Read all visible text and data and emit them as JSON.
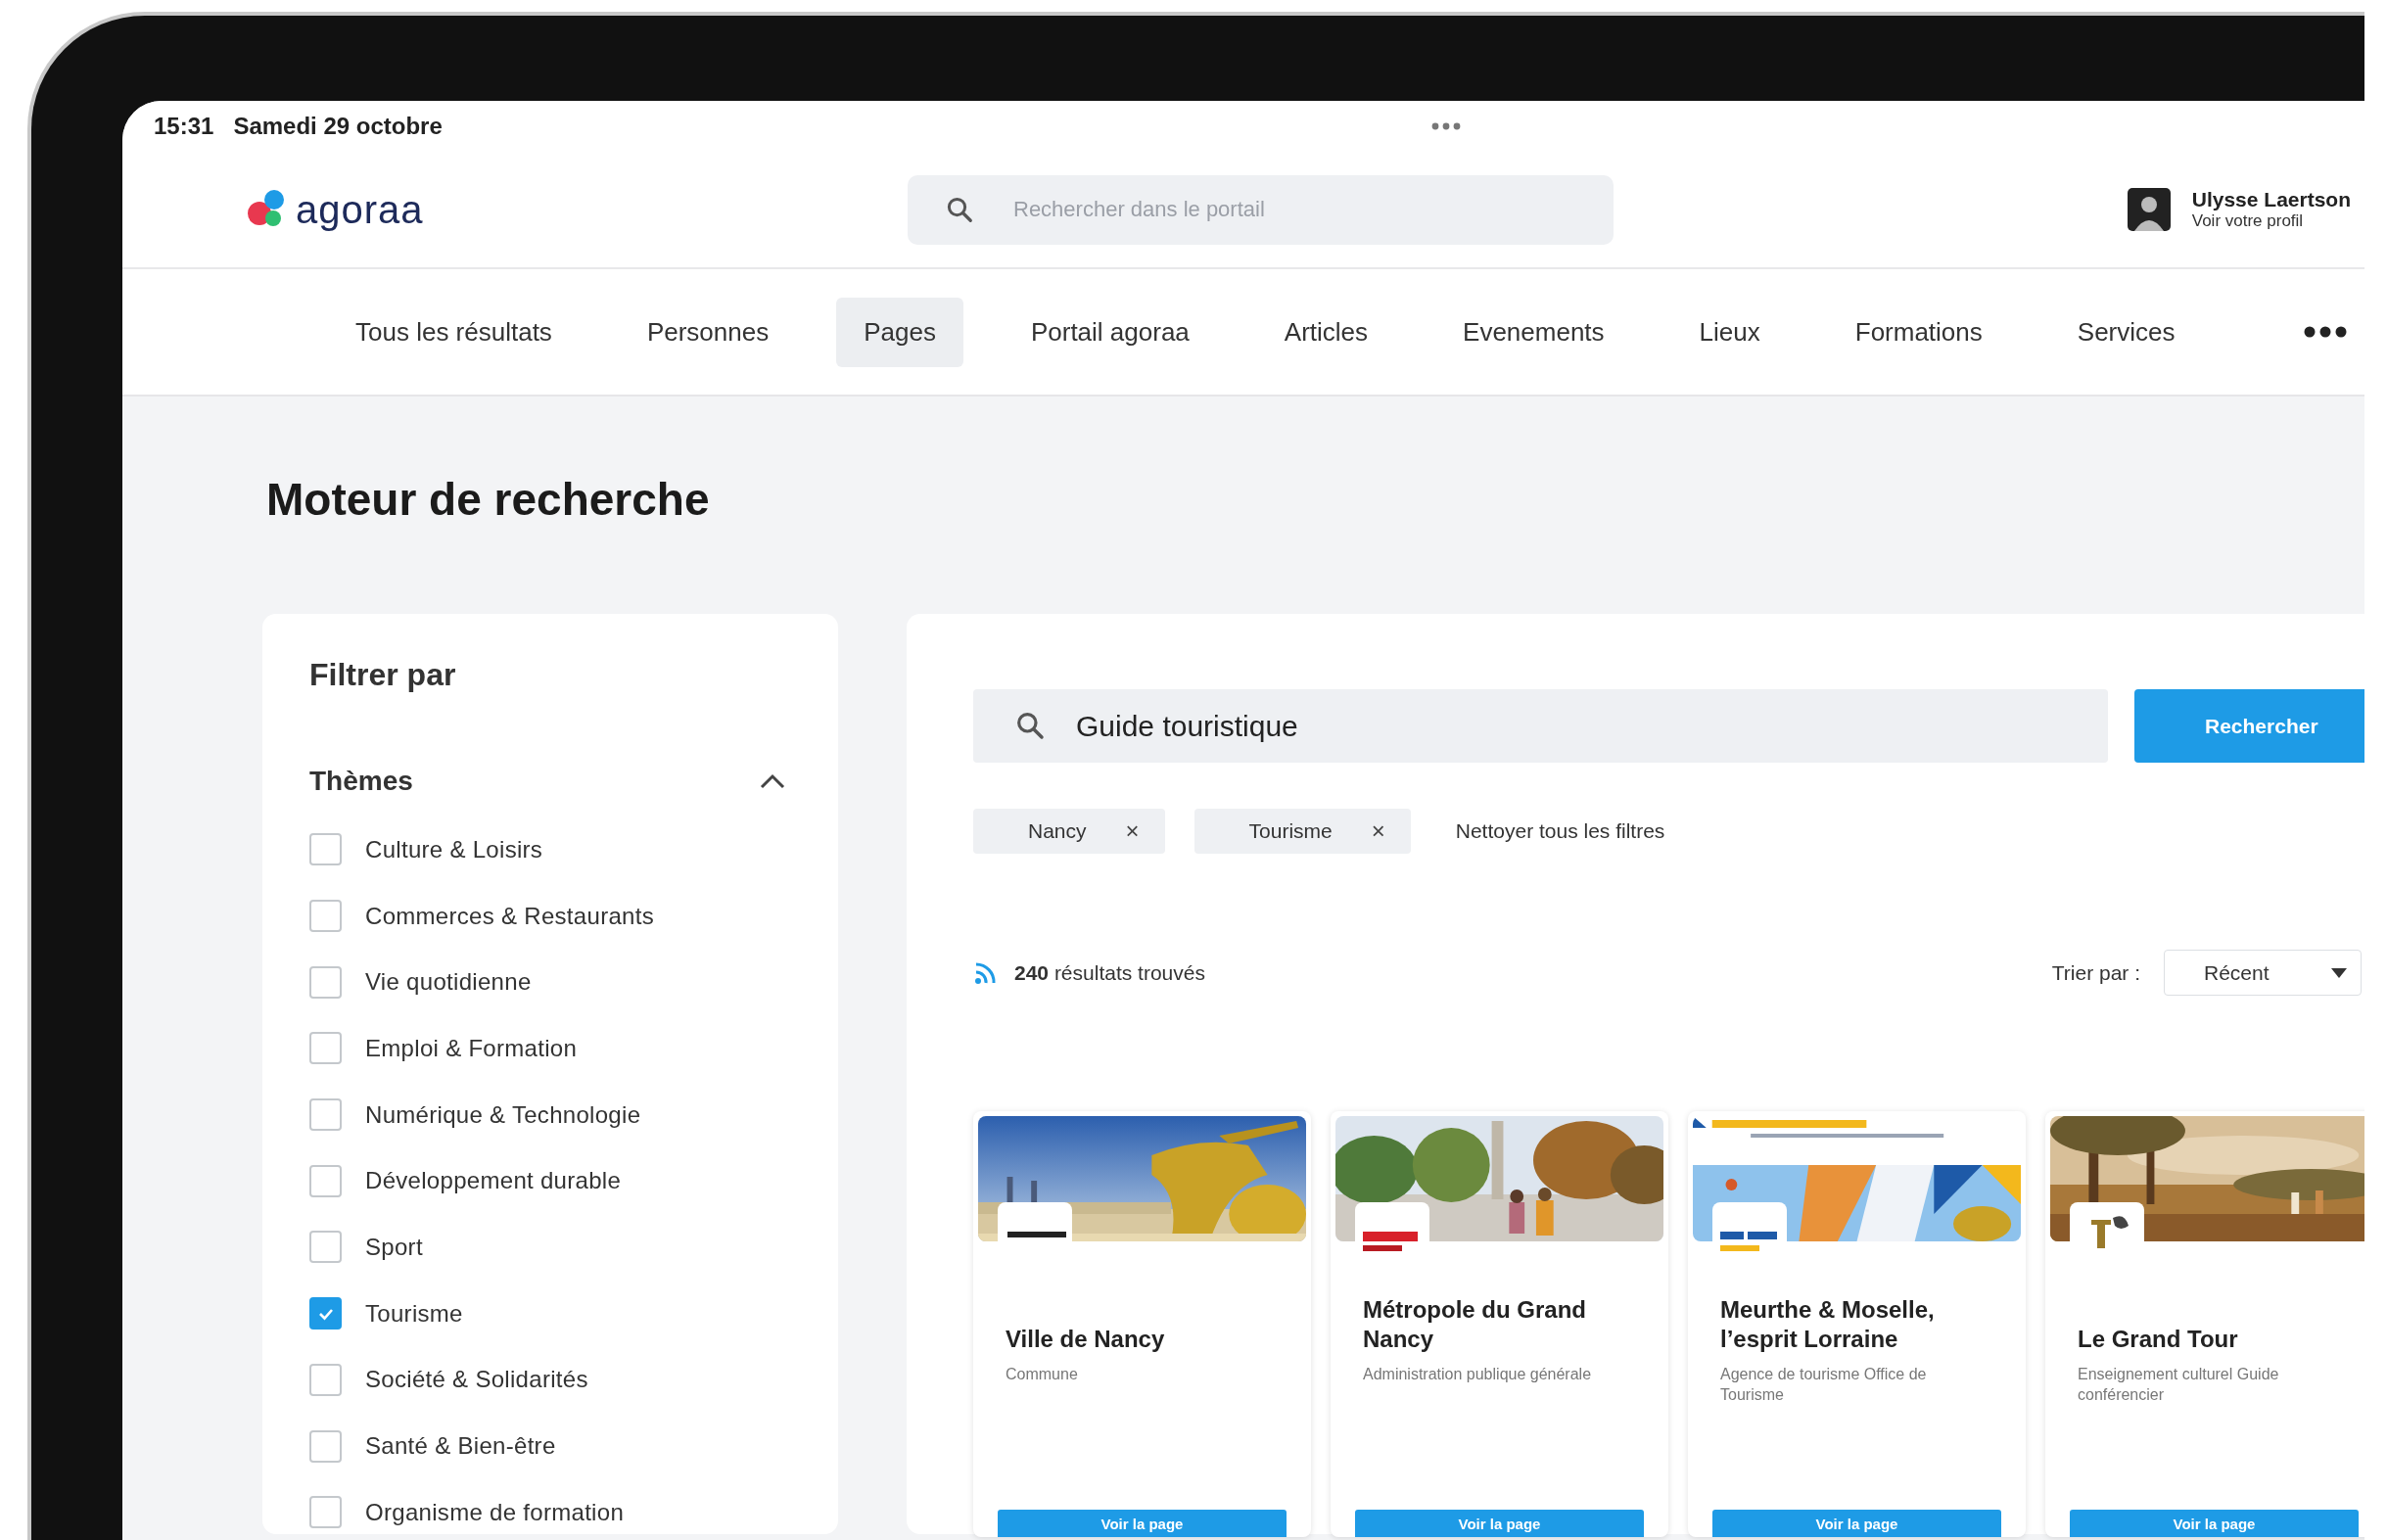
{
  "status_bar": {
    "time": "15:31",
    "date": "Samedi 29 octobre"
  },
  "header": {
    "brand": "agoraa",
    "search": {
      "placeholder": "Rechercher dans le portail"
    },
    "user": {
      "name": "Ulysse Laertson",
      "link": "Voir votre profil"
    }
  },
  "nav": {
    "tabs": [
      {
        "label": "Tous les résultats",
        "selected": false
      },
      {
        "label": "Personnes",
        "selected": false
      },
      {
        "label": "Pages",
        "selected": true
      },
      {
        "label": "Portail agoraa",
        "selected": false
      },
      {
        "label": "Articles",
        "selected": false
      },
      {
        "label": "Evenements",
        "selected": false
      },
      {
        "label": "Lieux",
        "selected": false
      },
      {
        "label": "Formations",
        "selected": false
      },
      {
        "label": "Services",
        "selected": false
      }
    ]
  },
  "page": {
    "title": "Moteur de recherche"
  },
  "filters": {
    "title": "Filtrer par",
    "section": {
      "title": "Thèmes",
      "expanded": true,
      "options": [
        {
          "label": "Culture & Loisirs",
          "checked": false
        },
        {
          "label": "Commerces & Restaurants",
          "checked": false
        },
        {
          "label": "Vie quotidienne",
          "checked": false
        },
        {
          "label": "Emploi & Formation",
          "checked": false
        },
        {
          "label": "Numérique & Technologie",
          "checked": false
        },
        {
          "label": "Développement durable",
          "checked": false
        },
        {
          "label": "Sport",
          "checked": false
        },
        {
          "label": "Tourisme",
          "checked": true
        },
        {
          "label": "Société & Solidarités",
          "checked": false
        },
        {
          "label": "Santé & Bien-être",
          "checked": false
        },
        {
          "label": "Organisme de formation",
          "checked": false
        }
      ]
    }
  },
  "search": {
    "value": "Guide touristique",
    "button": "Rechercher"
  },
  "chips": [
    {
      "label": "Nancy",
      "remove": "×"
    },
    {
      "label": "Tourisme",
      "remove": "×"
    }
  ],
  "clear_filters": "Nettoyer tous les filtres",
  "results": {
    "count": "**240** résultats trouvés",
    "sort_label": "Trier par :",
    "sort_value": "Récent"
  },
  "cards": [
    {
      "title": "Ville de Nancy",
      "subtitle": "Commune",
      "button": "Voir la page"
    },
    {
      "title": "Métropole du Grand Nancy",
      "subtitle": "Administration publique générale",
      "button": "Voir la page"
    },
    {
      "title": "Meurthe & Moselle, l’esprit Lorraine",
      "subtitle": "Agence de tourisme Office de Tourisme",
      "button": "Voir la page"
    },
    {
      "title": "Le Grand Tour",
      "subtitle": "Enseignement culturel Guide conférencier",
      "button": "Voir la page"
    }
  ]
}
